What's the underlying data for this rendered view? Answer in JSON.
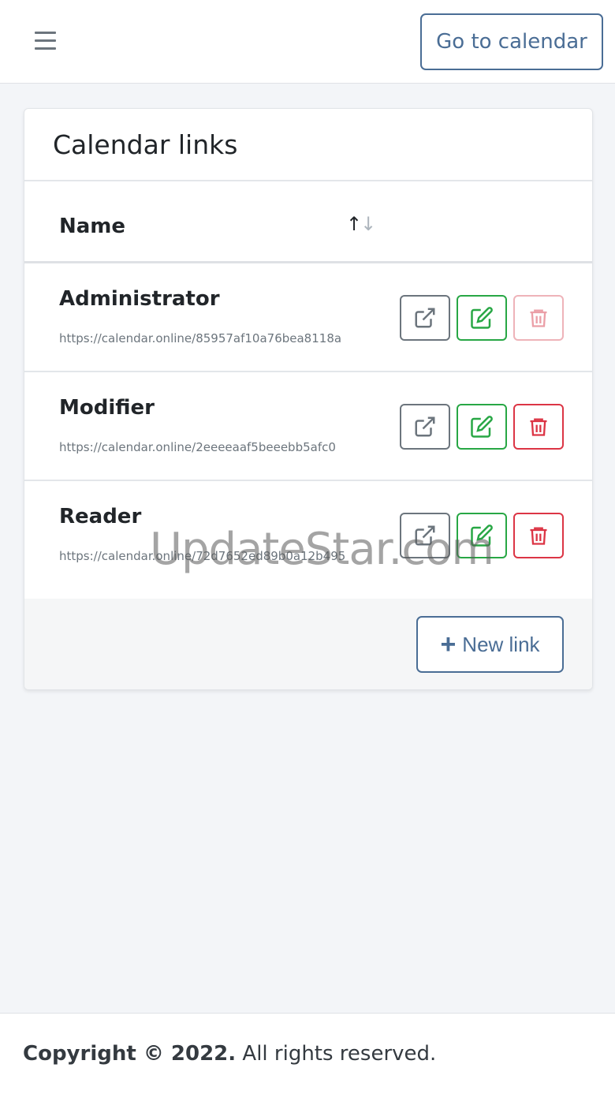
{
  "header": {
    "goto_label": "Go to calendar"
  },
  "card": {
    "title": "Calendar links",
    "column_name": "Name",
    "rows": [
      {
        "name": "Administrator",
        "url": "https://calendar.online/85957af10a76bea8118a",
        "delete_disabled": true
      },
      {
        "name": "Modifier",
        "url": "https://calendar.online/2eeeeaaf5beeebb5afc0",
        "delete_disabled": false
      },
      {
        "name": "Reader",
        "url": "https://calendar.online/72d7652ed89b0a12b495",
        "delete_disabled": false
      }
    ],
    "new_link_label": "New link"
  },
  "watermark": "UpdateStar.com",
  "footer": {
    "copyright_bold": "Copyright © 2022.",
    "copyright_rest": "All rights reserved."
  },
  "colors": {
    "primary": "#4a6d95",
    "success": "#28a745",
    "danger": "#dc3545",
    "muted": "#6c757d"
  },
  "icons": {
    "menu": "hamburger-icon",
    "open": "external-link-icon",
    "edit": "edit-icon",
    "delete": "trash-icon",
    "sort": "sort-icon",
    "add": "plus-icon"
  }
}
